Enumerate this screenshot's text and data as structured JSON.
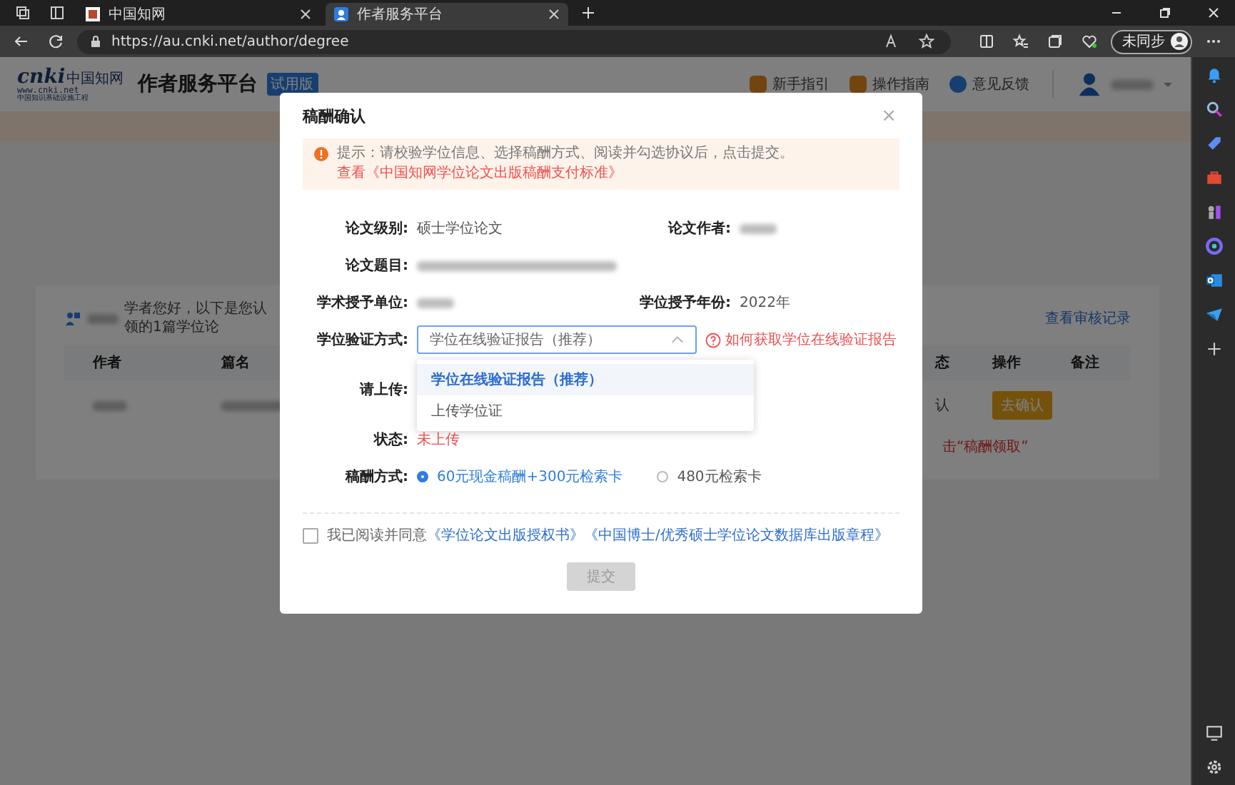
{
  "browser": {
    "tabs": [
      {
        "title": "中国知网",
        "selected": false
      },
      {
        "title": "作者服务平台",
        "selected": true
      }
    ],
    "url": "https://au.cnki.net/author/degree",
    "profile_button": "未同步"
  },
  "header": {
    "logo_word": "cnki",
    "logo_cn": "中国知网",
    "logo_url": "www.cnki.net",
    "logo_caption": "中国知识基础设施工程",
    "title": "作者服务平台",
    "badge": "试用版",
    "links": [
      "新手指引",
      "操作指南",
      "意见反馈"
    ]
  },
  "page": {
    "greeting": "学者您好，以下是您认领的1篇学位论",
    "records_link": "查看审核记录",
    "columns": [
      "作者",
      "篇名",
      "态",
      "操作",
      "备注"
    ],
    "row_status": "认",
    "row_action": "去确认",
    "notice": "击“稿酬领取”"
  },
  "dialog": {
    "title": "稿酬确认",
    "close": "×",
    "tip": "提示：请校验学位信息、选择稿酬方式、阅读并勾选协议后，点击提交。",
    "tip_link": "查看《中国知网学位论文出版稿酬支付标准》",
    "rows": [
      [
        {
          "label": "论文级别:",
          "value": "硕士学位论文"
        },
        {
          "label": "论文作者:",
          "kind": "redacted"
        }
      ],
      [
        {
          "label": "论文题目:",
          "kind": "redacted"
        }
      ],
      [
        {
          "label": "学术授予单位:",
          "kind": "redacted"
        },
        {
          "label": "学位授予年份:",
          "value": "2022年"
        }
      ]
    ],
    "select": {
      "label": "学位验证方式:",
      "value": "学位在线验证报告（推荐）",
      "expanded": true,
      "help": "如何获取学位在线验证报告",
      "options": [
        {
          "label": "学位在线验证报告（推荐）",
          "selected": true
        },
        {
          "label": "上传学位证",
          "selected": false
        }
      ]
    },
    "upload_label": "请上传:",
    "status_label": "状态:",
    "status_value": "未上传",
    "payment_label": "稿酬方式:",
    "payment_options": [
      {
        "label": "60元现金稿酬+300元检索卡",
        "selected": true
      },
      {
        "label": "480元检索卡",
        "selected": false
      }
    ],
    "agreement": {
      "checked": false,
      "text": "我已阅读并同意",
      "links": [
        "《学位论文出版授权书》",
        "《中国博士/优秀硕士学位论文数据库出版章程》"
      ]
    },
    "submit": {
      "label": "提交",
      "disabled": true
    }
  }
}
